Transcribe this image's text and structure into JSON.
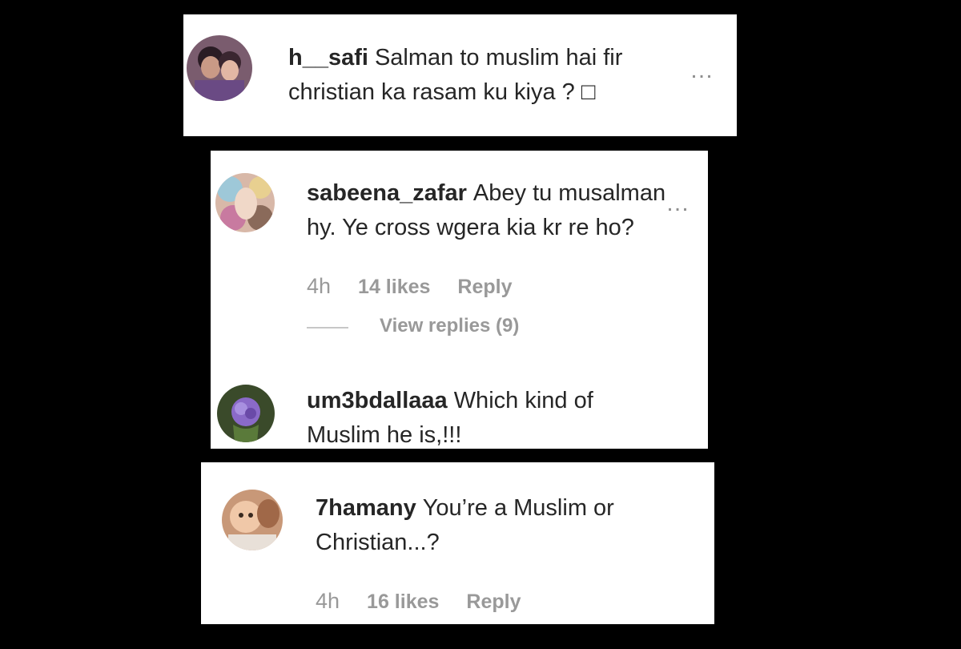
{
  "comments": [
    {
      "username": "h__safi",
      "text_line1": "Salman to muslim hai fir",
      "text_line2": "christian ka rasam ku kiya ? □",
      "more_icon": "…"
    },
    {
      "username": "sabeena_zafar",
      "text_line1": "Abey tu musalman",
      "text_line2": "hy. Ye cross wgera kia kr re ho?",
      "more_icon": "…",
      "time": "4h",
      "likes": "14 likes",
      "reply": "Reply",
      "view_replies": "View replies (9)"
    },
    {
      "username": "um3bdallaaa",
      "text_line1": "Which kind of",
      "text_line2": "Muslim he is,!!!"
    },
    {
      "username": "7hamany",
      "text_line1": "You’re a Muslim or",
      "text_line2": "Christian...?",
      "time": "4h",
      "likes": "16 likes",
      "reply": "Reply"
    }
  ],
  "colors": {
    "background": "#000000",
    "card": "#ffffff",
    "text": "#262626",
    "meta": "#999999"
  }
}
